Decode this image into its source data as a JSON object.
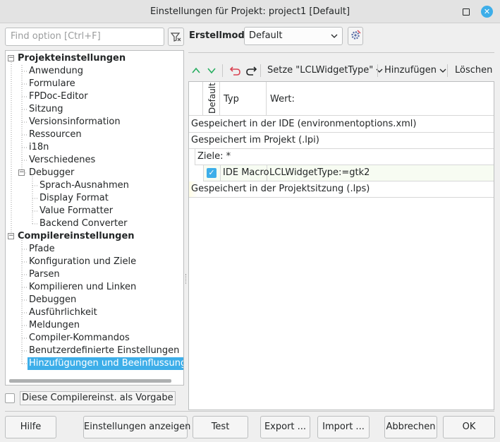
{
  "window": {
    "title": "Einstellungen für Projekt: project1 [Default]"
  },
  "search": {
    "placeholder": "Find option [Ctrl+F]"
  },
  "tree": {
    "items": [
      {
        "label": "Projekteinstellungen",
        "level": 0,
        "bold": true,
        "expander": "−"
      },
      {
        "label": "Anwendung",
        "level": 1
      },
      {
        "label": "Formulare",
        "level": 1
      },
      {
        "label": "FPDoc-Editor",
        "level": 1
      },
      {
        "label": "Sitzung",
        "level": 1
      },
      {
        "label": "Versionsinformation",
        "level": 1
      },
      {
        "label": "Ressourcen",
        "level": 1
      },
      {
        "label": "i18n",
        "level": 1
      },
      {
        "label": "Verschiedenes",
        "level": 1
      },
      {
        "label": "Debugger",
        "level": 1,
        "expander": "−"
      },
      {
        "label": "Sprach-Ausnahmen",
        "level": 2
      },
      {
        "label": "Display Format",
        "level": 2
      },
      {
        "label": "Value Formatter",
        "level": 2
      },
      {
        "label": "Backend Converter",
        "level": 2
      },
      {
        "label": "Compilereinstellungen",
        "level": 0,
        "bold": true,
        "expander": "−"
      },
      {
        "label": "Pfade",
        "level": 1
      },
      {
        "label": "Konfiguration und Ziele",
        "level": 1
      },
      {
        "label": "Parsen",
        "level": 1
      },
      {
        "label": "Kompilieren und Linken",
        "level": 1
      },
      {
        "label": "Debuggen",
        "level": 1
      },
      {
        "label": "Ausführlichkeit",
        "level": 1
      },
      {
        "label": "Meldungen",
        "level": 1
      },
      {
        "label": "Compiler-Kommandos",
        "level": 1
      },
      {
        "label": "Benutzerdefinierte Einstellungen",
        "level": 1
      },
      {
        "label": "Hinzufügungen und Beeinflussungen",
        "level": 1,
        "selected": true
      }
    ]
  },
  "default_checkbox": {
    "label": "Diese Compilereinst. als Vorgabe",
    "checked": false
  },
  "buildmode": {
    "label": "Erstellmodi",
    "value": "Default"
  },
  "toolbar": {
    "move_up_icon": "chevron-up-icon",
    "move_down_icon": "chevron-down-icon",
    "undo_icon": "undo-icon",
    "redo_icon": "redo-icon",
    "set_label": "Setze \"LCLWidgetType\"",
    "add_label": "Hinzufügen",
    "delete_label": "Löschen"
  },
  "grid": {
    "headers": {
      "default": "Default",
      "type": "Typ",
      "value": "Wert:"
    },
    "rows": {
      "ide": "Gespeichert in der IDE (environmentoptions.xml)",
      "project": "Gespeichert im Projekt (.lpi)",
      "targets": "Ziele: *",
      "macro_type": "IDE Macro",
      "macro_value": "LCLWidgetType:=gtk2",
      "session": "Gespeichert in der Projektsitzung (.lps)"
    }
  },
  "buttons": {
    "help": "Hilfe",
    "show_options": "Einstellungen anzeigen",
    "test": "Test",
    "export": "Export ...",
    "import": "Import ...",
    "cancel": "Abbrechen",
    "ok": "OK"
  },
  "colors": {
    "accent": "#3daee9",
    "green": "#27ae60",
    "red": "#da4453"
  }
}
